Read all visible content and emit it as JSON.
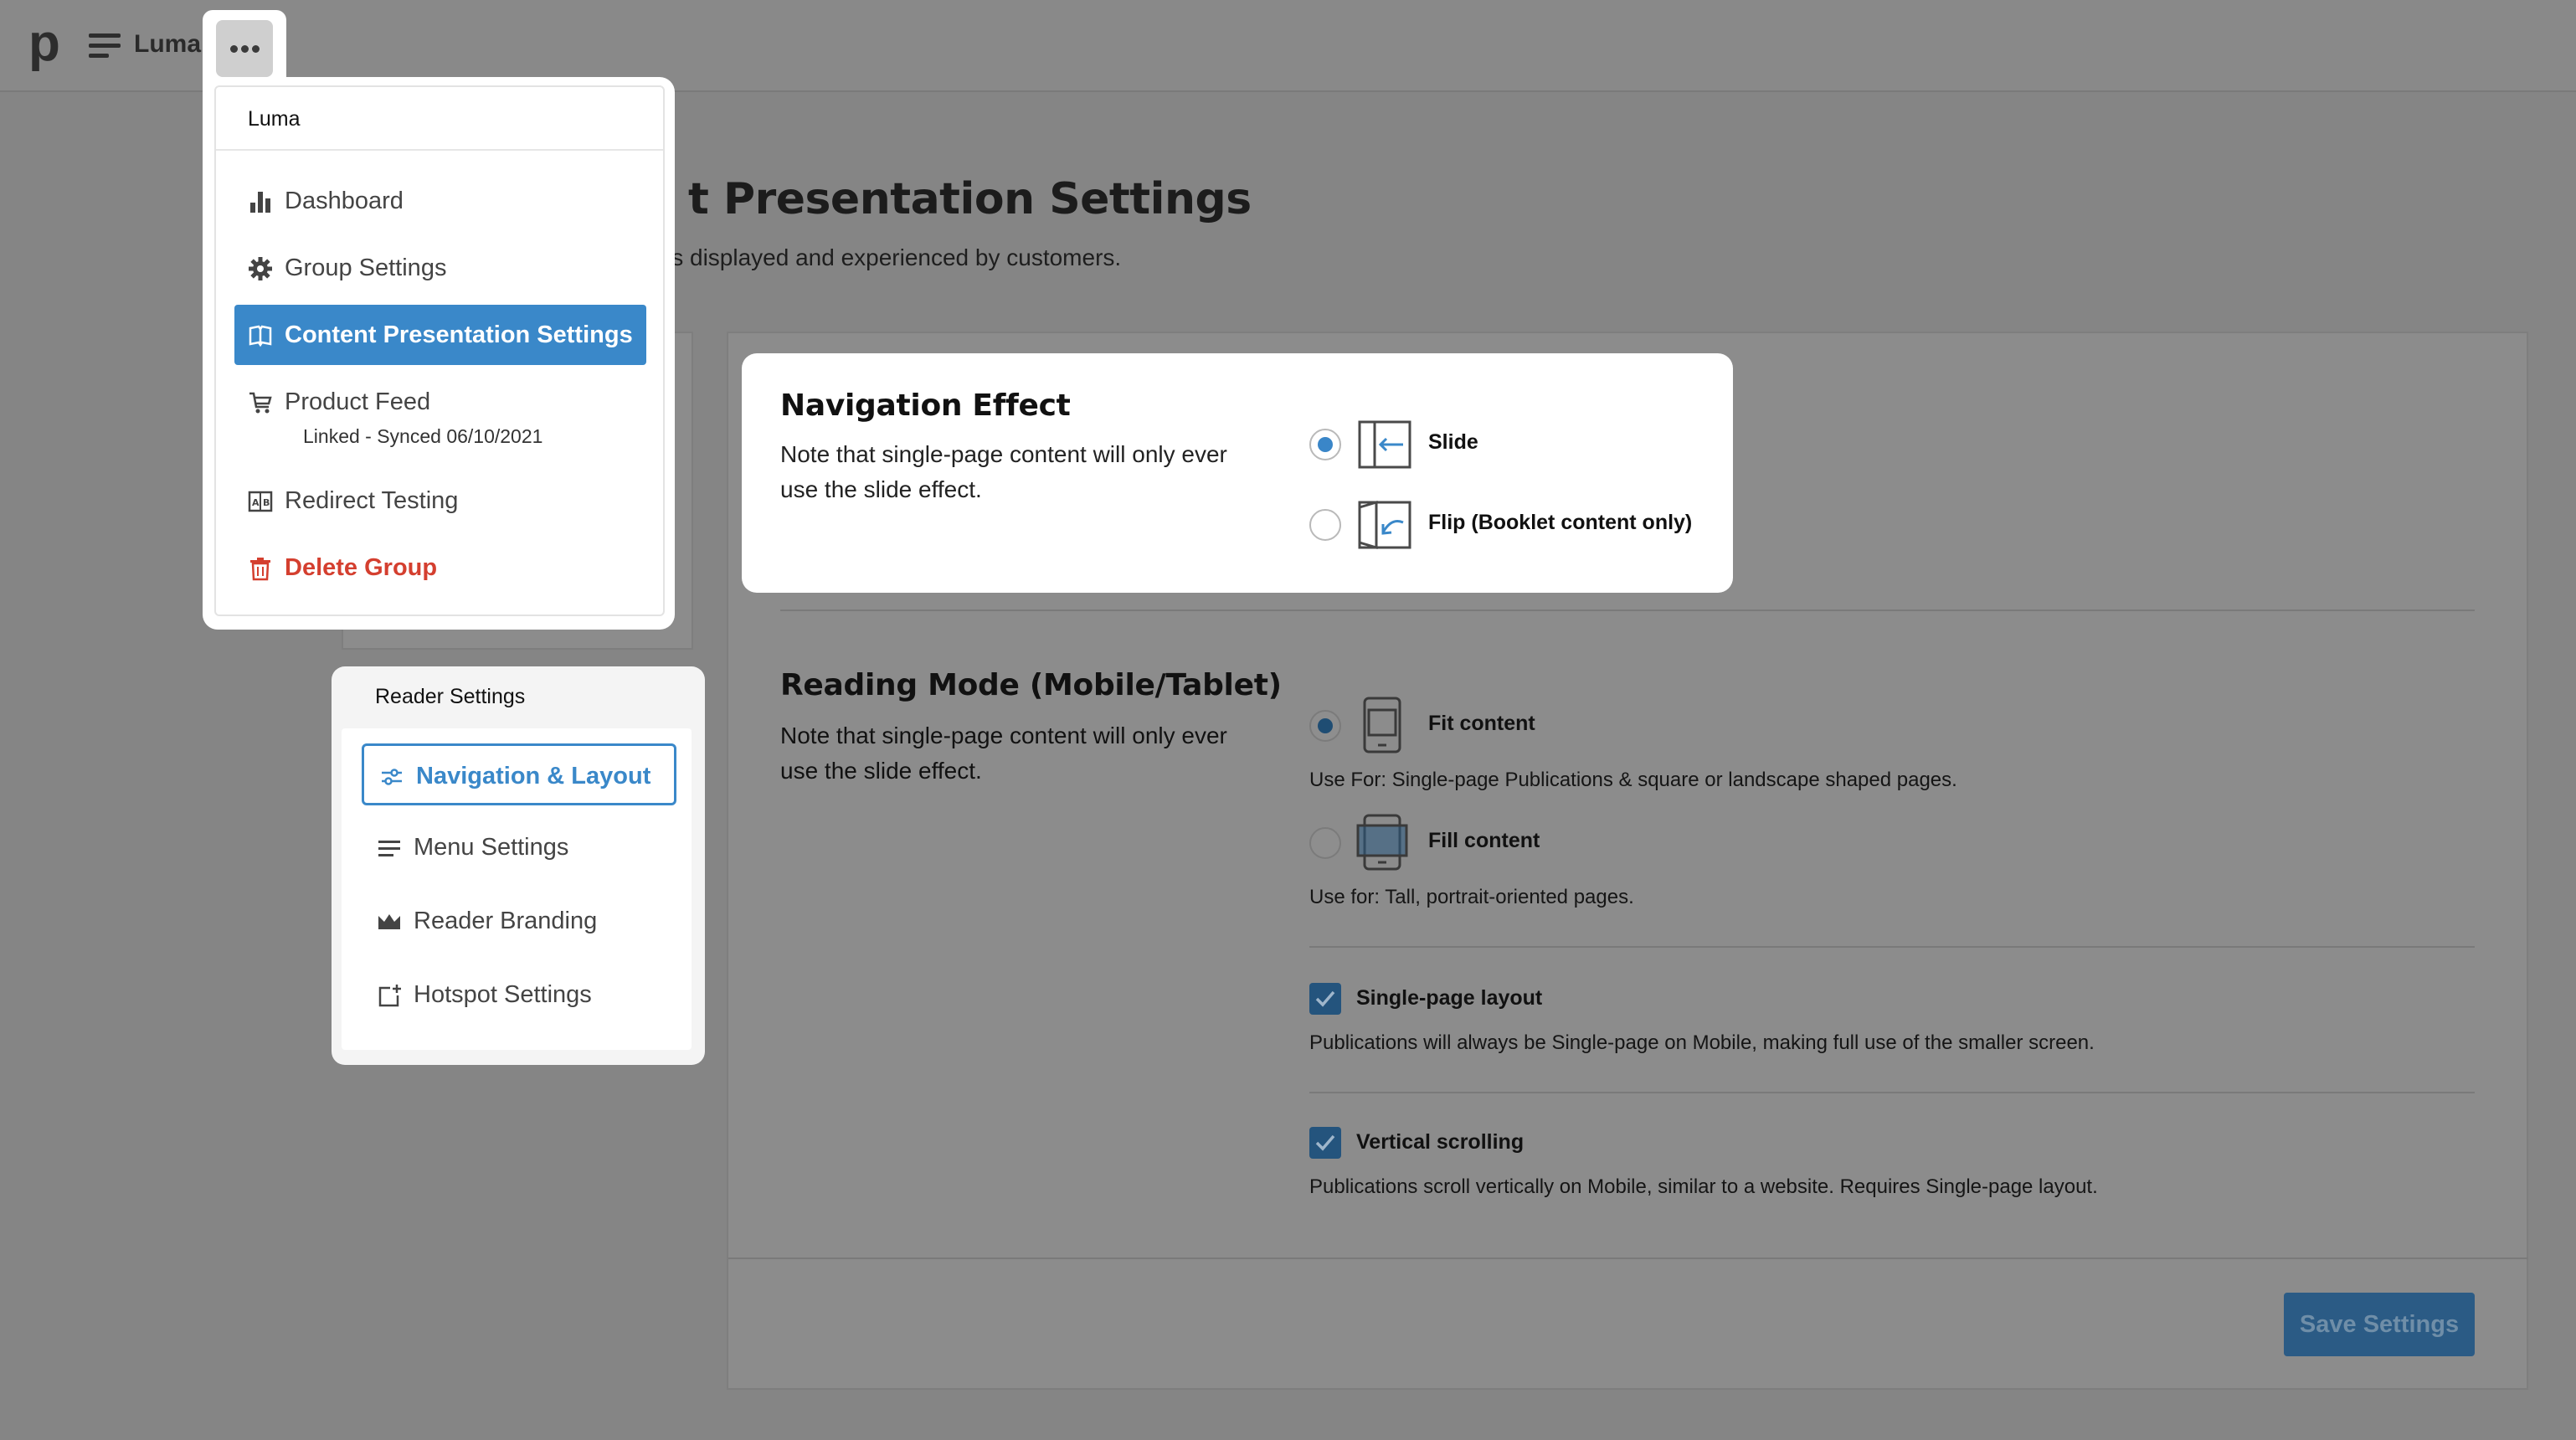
{
  "app": {
    "group_name": "Luma"
  },
  "page": {
    "title": "t Presentation Settings",
    "subtitle": "is displayed and experienced by customers."
  },
  "dropdown": {
    "header": "Luma",
    "items": [
      {
        "label": "Dashboard",
        "icon": "bar-chart-icon"
      },
      {
        "label": "Group Settings",
        "icon": "gear-icon"
      },
      {
        "label": "Content Presentation Settings",
        "icon": "book-icon",
        "active": true
      },
      {
        "label": "Product Feed",
        "icon": "cart-icon",
        "sub": "Linked - Synced 06/10/2021"
      },
      {
        "label": "Redirect Testing",
        "icon": "ab-test-icon"
      },
      {
        "label": "Delete Group",
        "icon": "trash-icon",
        "danger": true
      }
    ]
  },
  "reader_settings": {
    "title": "Reader Settings",
    "items": [
      {
        "label": "Navigation & Layout",
        "icon": "sliders-icon",
        "active": true
      },
      {
        "label": "Menu Settings",
        "icon": "menu-lines-icon"
      },
      {
        "label": "Reader Branding",
        "icon": "crown-icon"
      },
      {
        "label": "Hotspot Settings",
        "icon": "hotspot-icon"
      }
    ]
  },
  "navigation_effect": {
    "title": "Navigation Effect",
    "note": "Note that single-page content will only ever use the slide effect.",
    "options": [
      {
        "label": "Slide",
        "selected": true
      },
      {
        "label": "Flip (Booklet content only)",
        "selected": false
      }
    ]
  },
  "reading_mode": {
    "title": "Reading Mode (Mobile/Tablet)",
    "note": "Note that single-page content will only ever use the slide effect.",
    "options": [
      {
        "label": "Fit content",
        "help": "Use For: Single-page Publications & square or landscape shaped pages.",
        "selected": true
      },
      {
        "label": "Fill content",
        "help": "Use for: Tall, portrait-oriented pages.",
        "selected": false
      }
    ],
    "checkboxes": [
      {
        "label": "Single-page layout",
        "help": "Publications will always be Single-page on Mobile, making full use of the smaller screen.",
        "checked": true
      },
      {
        "label": "Vertical scrolling",
        "help": "Publications scroll vertically on Mobile, similar to a website. Requires Single-page layout.",
        "checked": true
      }
    ]
  },
  "actions": {
    "save_label": "Save Settings"
  },
  "colors": {
    "accent": "#3a88c9",
    "danger": "#d43f2f",
    "overlay_bg": "#858585"
  }
}
